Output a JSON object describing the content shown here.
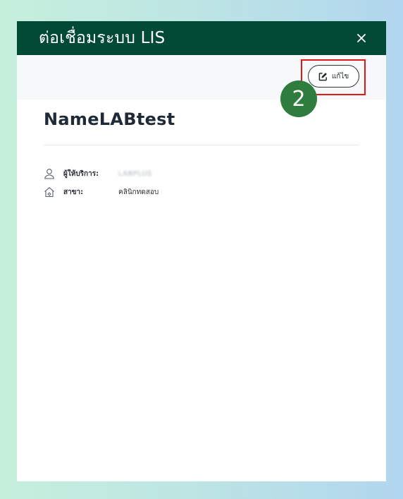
{
  "header": {
    "title": "ต่อเชื่อมระบบ LIS",
    "close_icon": "close-icon"
  },
  "toolbar": {
    "edit_label": "แก้ไข",
    "edit_icon": "edit-icon",
    "highlight_color": "#e01818"
  },
  "step_badge": {
    "number": "2",
    "color": "#2f7d3e"
  },
  "lab": {
    "name": "NameLABtest"
  },
  "info": [
    {
      "icon": "user-icon",
      "label": "ผู้ให้บริการ:",
      "value": "LABPLUS"
    },
    {
      "icon": "home-icon",
      "label": "สาขา:",
      "value": "คลินิกทดสอบ"
    }
  ],
  "colors": {
    "header_bg": "#024a35",
    "toolbar_bg": "#f6f8fa"
  }
}
